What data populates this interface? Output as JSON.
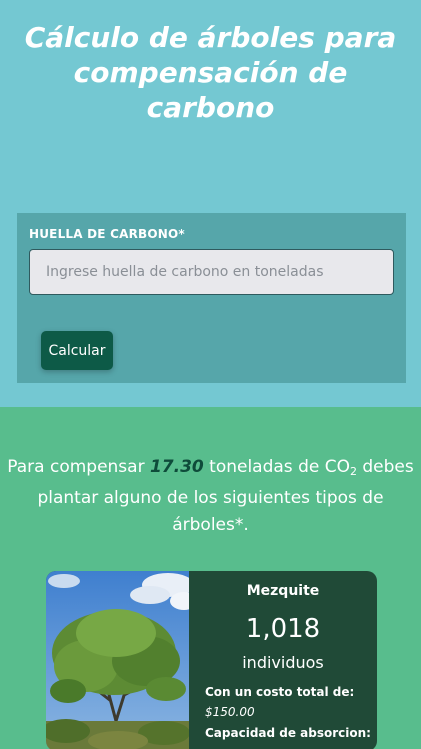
{
  "header": {
    "title": "Cálculo de árboles para compensación de carbono"
  },
  "form": {
    "label": "HUELLA DE CARBONO*",
    "input_placeholder": "Ingrese huella de carbono en toneladas",
    "input_value": "",
    "button_label": "Calcular"
  },
  "result": {
    "text_before": "Para compensar ",
    "amount": "17.30",
    "text_mid": " toneladas de CO",
    "subscript": "2",
    "text_after": " debes plantar alguno de los siguientes tipos de árboles*."
  },
  "tree_card": {
    "name": "Mezquite",
    "count": "1,018",
    "unit": "individuos",
    "cost_label": "Con un costo total de:",
    "cost_value": "$150.00",
    "absorption_label": "Capacidad de absorcion:"
  },
  "colors": {
    "top_background": "#74c8d2",
    "form_background": "#56a6aa",
    "button": "#0d5a47",
    "bottom_background": "#58bd8d",
    "card_background": "#204a37",
    "amount_text": "#0e4b3a"
  }
}
